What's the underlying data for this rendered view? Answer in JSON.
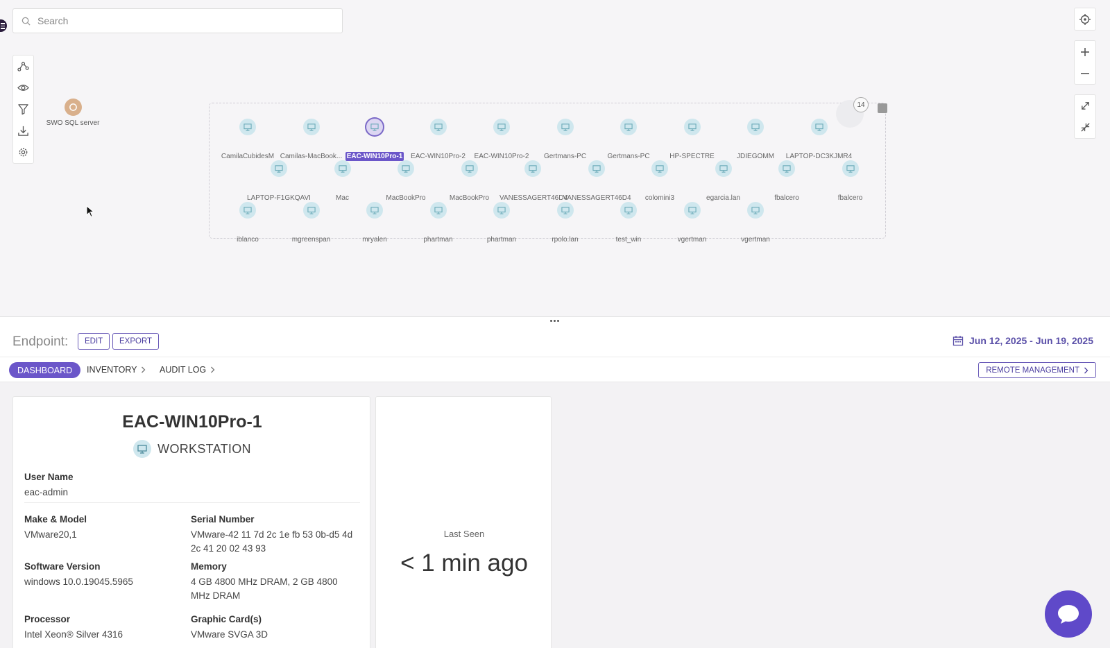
{
  "search": {
    "placeholder": "Search"
  },
  "map": {
    "server": {
      "label": "SWO SQL server"
    },
    "group_count": "14",
    "nodes": [
      "CamilaCubidesM",
      "Camilas-MacBook...",
      "EAC-WIN10Pro-1",
      "EAC-WIN10Pro-2",
      "EAC-WIN10Pro-2",
      "Gertmans-PC",
      "Gertmans-PC",
      "HP-SPECTRE",
      "JDIEGOMM",
      "LAPTOP-DC3KJMR4",
      "LAPTOP-F1GKQAVI",
      "Mac",
      "MacBookPro",
      "MacBookPro",
      "VANESSAGERT46D4",
      "VANESSAGERT46D4",
      "colomini3",
      "egarcia.lan",
      "fbalcero",
      "fbalcero",
      "iblanco",
      "mgreenspan",
      "mryalen",
      "phartman",
      "phartman",
      "rpolo.lan",
      "test_win",
      "vgertman",
      "vgertman"
    ],
    "selected_node": "EAC-WIN10Pro-1"
  },
  "endpoint": {
    "label": "Endpoint:",
    "edit": "EDIT",
    "export": "EXPORT",
    "date_range": "Jun 12, 2025 - Jun 19, 2025"
  },
  "tabs": {
    "dashboard": "DASHBOARD",
    "inventory": "INVENTORY",
    "audit_log": "AUDIT LOG",
    "remote": "REMOTE MANAGEMENT"
  },
  "device": {
    "name": "EAC-WIN10Pro-1",
    "type": "WORKSTATION",
    "user_name_label": "User Name",
    "user_name": "eac-admin",
    "make_model_label": "Make & Model",
    "make_model": "VMware20,1",
    "serial_label": "Serial Number",
    "serial": "VMware-42 11 7d 2c 1e fb 53 0b-d5 4d 2c 41 20 02 43 93",
    "software_label": "Software Version",
    "software": "windows 10.0.19045.5965",
    "memory_label": "Memory",
    "memory": "4 GB 4800 MHz DRAM, 2 GB 4800 MHz DRAM",
    "processor_label": "Processor",
    "processor": "Intel Xeon® Silver 4316",
    "graphics_label": "Graphic Card(s)",
    "graphics": "VMware SVGA 3D"
  },
  "last_seen": {
    "label": "Last Seen",
    "value": "< 1 min ago"
  },
  "colors": {
    "accent": "#6b56c9",
    "node": "#cfe7ee",
    "server": "#d9b08c"
  },
  "icons": [
    "search-icon",
    "topology-icon",
    "eye-icon",
    "filter-icon",
    "download-icon",
    "gear-icon",
    "locate-icon",
    "plus-icon",
    "minus-icon",
    "expand-icon",
    "collapse-icon",
    "calendar-icon",
    "chevron-right-icon",
    "chat-icon",
    "workstation-icon"
  ]
}
